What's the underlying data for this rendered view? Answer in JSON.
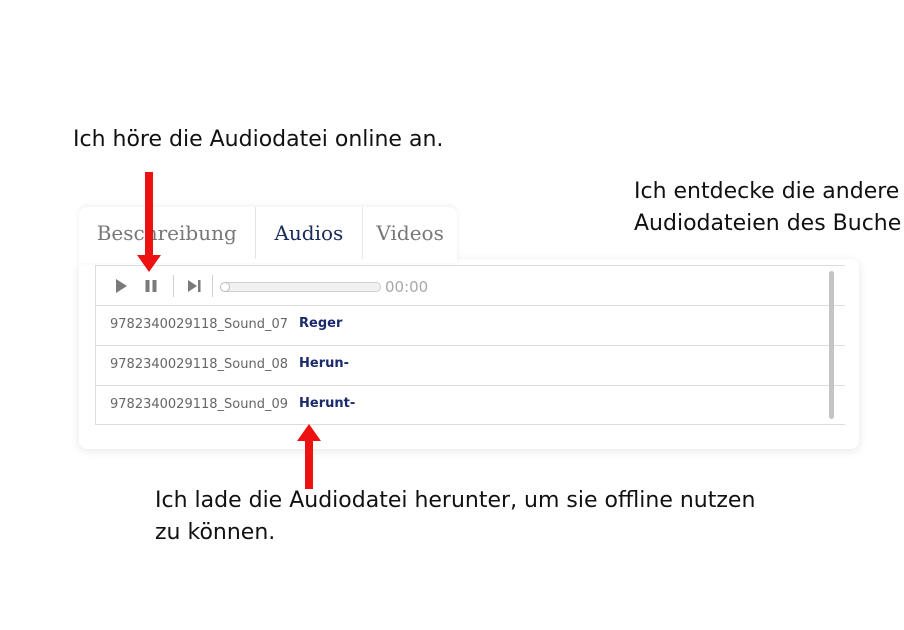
{
  "annotations": {
    "top": "Ich höre die Audiodatei online an.",
    "right_line1": "Ich entdecke die andere",
    "right_line2": "Audiodateien des Buche",
    "bottom_line1": "Ich lade die Audiodatei herunter, um sie offline nutzen",
    "bottom_line2": "zu können."
  },
  "tabs": [
    {
      "label": "Beschreibung",
      "active": false
    },
    {
      "label": "Audios",
      "active": true
    },
    {
      "label": "Videos",
      "active": false
    }
  ],
  "player": {
    "time": "00:00",
    "progress": 0
  },
  "tracks": [
    {
      "name": "9782340029118_Sound_07",
      "action": "Reger"
    },
    {
      "name": "9782340029118_Sound_08",
      "action": "Herun-"
    },
    {
      "name": "9782340029118_Sound_09",
      "action": "Herunt-"
    }
  ],
  "icons": {
    "play": "play-icon",
    "pause": "pause-icon",
    "next": "skip-next-icon",
    "arrows": "red-arrow-icon"
  },
  "colors": {
    "active_tab": "#1a2a5c",
    "link": "#1a2a6c",
    "arrow": "#ee1111",
    "inactive_tab": "#777777"
  }
}
